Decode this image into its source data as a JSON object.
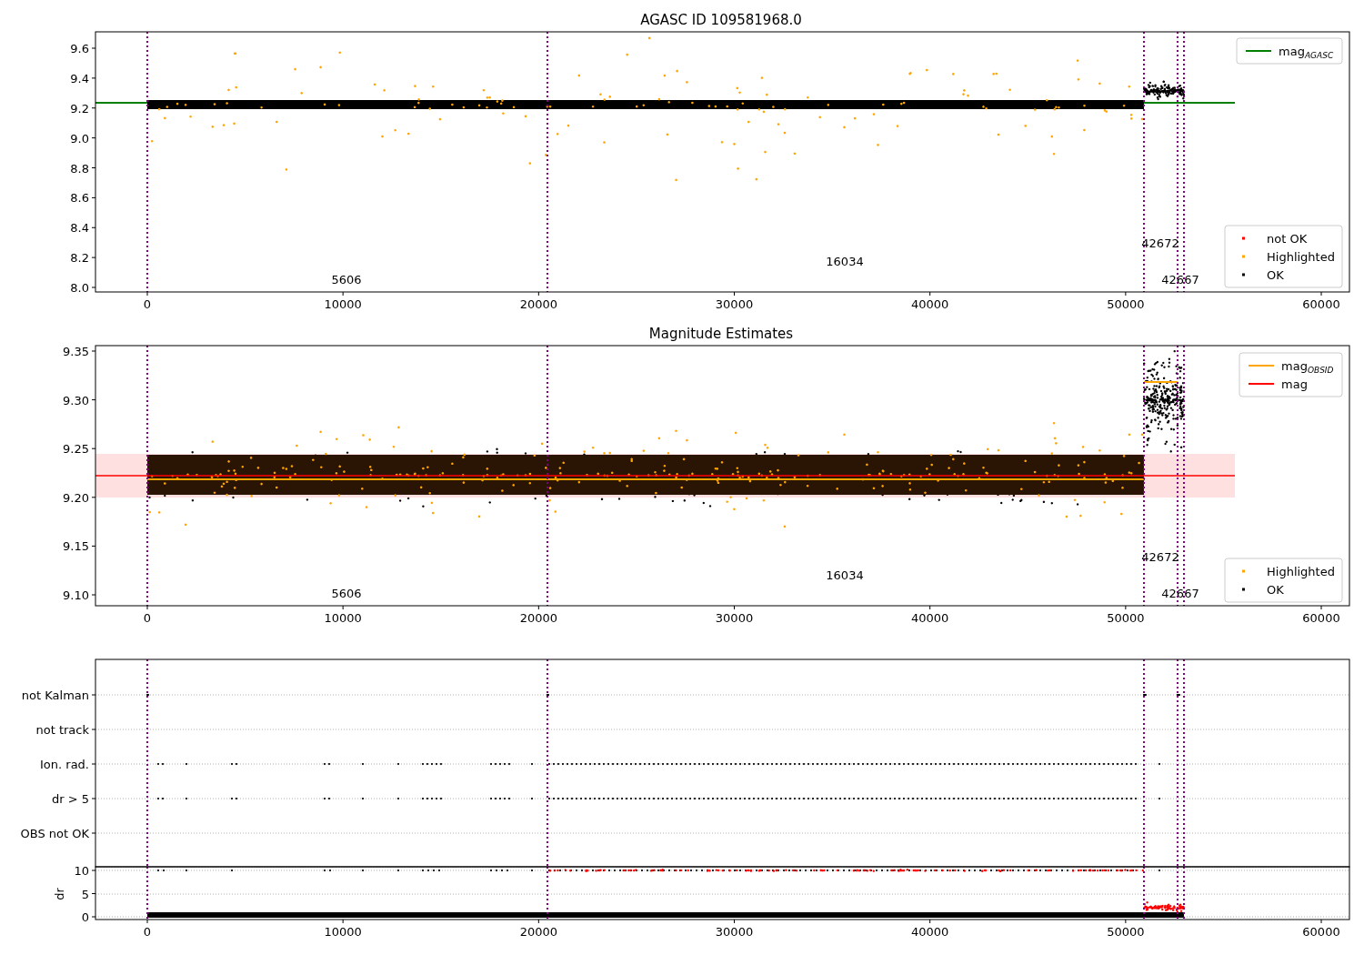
{
  "figure": {
    "panels": [
      {
        "title": "AGASC ID 109581968.0",
        "yticks": [
          "9.6",
          "9.4",
          "9.2",
          "9.0",
          "8.8",
          "8.6",
          "8.4",
          "8.2",
          "8.0"
        ],
        "xticks": [
          "0",
          "10000",
          "20000",
          "30000",
          "40000",
          "50000",
          "60000"
        ],
        "annotations": [
          {
            "text": "5606"
          },
          {
            "text": "16034"
          },
          {
            "text": "42672"
          },
          {
            "text": "42667"
          }
        ],
        "legends": [
          {
            "items": [
              {
                "label": "mag$_{AGASC}$",
                "kind": "line",
                "color": "#008000"
              }
            ]
          },
          {
            "items": [
              {
                "label": "not OK",
                "kind": "marker",
                "color": "#ff0000"
              },
              {
                "label": "Highlighted",
                "kind": "marker",
                "color": "#ffa500"
              },
              {
                "label": "OK",
                "kind": "marker",
                "color": "#000000"
              }
            ]
          }
        ]
      },
      {
        "title": "Magnitude Estimates",
        "yticks": [
          "9.35",
          "9.30",
          "9.25",
          "9.20",
          "9.15",
          "9.10"
        ],
        "xticks": [
          "0",
          "10000",
          "20000",
          "30000",
          "40000",
          "50000",
          "60000"
        ],
        "annotations": [
          {
            "text": "5606"
          },
          {
            "text": "16034"
          },
          {
            "text": "42672"
          },
          {
            "text": "42667"
          }
        ],
        "legends": [
          {
            "items": [
              {
                "label": "mag$_{OBSID}$",
                "kind": "line",
                "color": "#ffa500"
              },
              {
                "label": "mag",
                "kind": "line",
                "color": "#ff0000"
              }
            ]
          },
          {
            "items": [
              {
                "label": "Highlighted",
                "kind": "marker",
                "color": "#ffa500"
              },
              {
                "label": "OK",
                "kind": "marker",
                "color": "#000000"
              }
            ]
          }
        ]
      },
      {
        "yticks": [
          "not Kalman",
          "not track",
          "Ion. rad.",
          "dr > 5",
          "OBS not OK"
        ]
      },
      {
        "ylabel": "dr",
        "yticks": [
          "10",
          "5",
          "0"
        ],
        "xticks": [
          "0",
          "10000",
          "20000",
          "30000",
          "40000",
          "50000",
          "60000"
        ]
      }
    ]
  }
}
